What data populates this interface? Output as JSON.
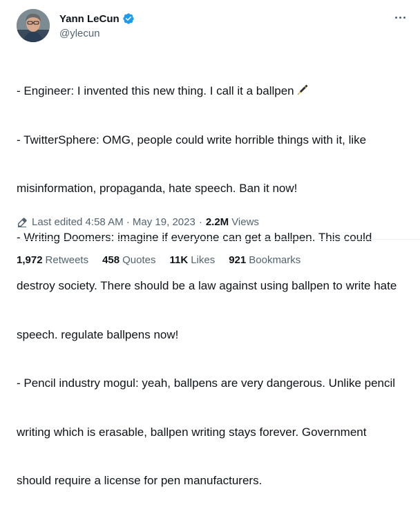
{
  "author": {
    "name": "Yann LeCun",
    "handle": "@ylecun",
    "verified": true
  },
  "tweet": {
    "lines": [
      "- Engineer: I invented this new thing. I call it a ballpen",
      "- TwitterSphere: OMG, people could write horrible things with it, like",
      "misinformation, propaganda, hate speech. Ban it now!",
      "- Writing Doomers: imagine if everyone can get a ballpen. This could",
      "destroy society. There should be a law against using ballpen to write hate",
      "speech. regulate ballpens now!",
      "- Pencil industry mogul: yeah, ballpens are very dangerous. Unlike pencil",
      "writing which is erasable, ballpen writing stays forever. Government",
      "should require a license for pen manufacturers."
    ],
    "emoji_icon": "fountain-pen-icon"
  },
  "meta": {
    "edited": "Last edited 4:58 AM · May 19, 2023",
    "separator": "·",
    "views_count": "2.2M",
    "views_label": "Views"
  },
  "stats": {
    "retweets": {
      "count": "1,972",
      "label": "Retweets"
    },
    "quotes": {
      "count": "458",
      "label": "Quotes"
    },
    "likes": {
      "count": "11K",
      "label": "Likes"
    },
    "bookmarks": {
      "count": "921",
      "label": "Bookmarks"
    }
  },
  "colors": {
    "text": "#0f1419",
    "secondary": "#536471",
    "verified": "#1d9bf0",
    "divider": "#eff3f4"
  }
}
